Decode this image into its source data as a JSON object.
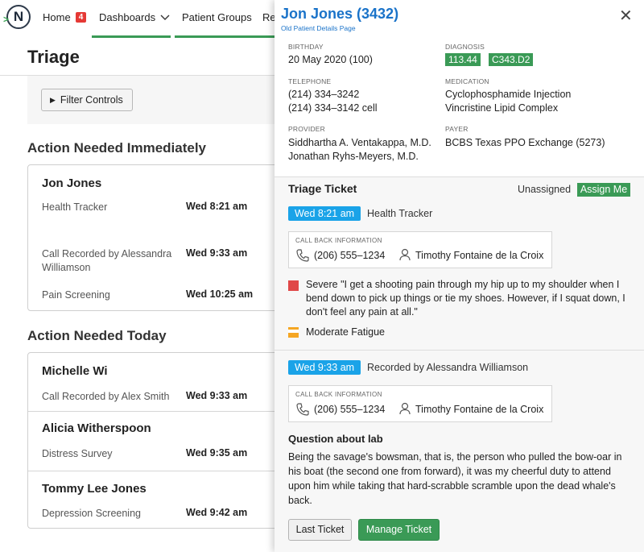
{
  "nav": {
    "home_label": "Home",
    "home_badge": "4",
    "dashboards_label": "Dashboards",
    "patient_groups_label": "Patient Groups",
    "truncated_label": "Re"
  },
  "page": {
    "title": "Triage",
    "filter_label": "Filter Controls"
  },
  "sections": {
    "immediate_title": "Action Needed Immediately",
    "today_title": "Action Needed Today"
  },
  "immediate_card": {
    "name": "Jon Jones",
    "rows": [
      {
        "label": "Health Tracker",
        "time": "Wed 8:21 am"
      },
      {
        "label": "Call Recorded by Alessandra Williamson",
        "time": "Wed 9:33 am"
      },
      {
        "label": "Pain Screening",
        "time": "Wed 10:25 am"
      }
    ]
  },
  "today_cards": [
    {
      "name": "Michelle Wi",
      "label": "Call Recorded by Alex Smith",
      "time": "Wed 9:33 am"
    },
    {
      "name": "Alicia Witherspoon",
      "label": "Distress Survey",
      "time": "Wed 9:35 am"
    },
    {
      "name": "Tommy Lee Jones",
      "label": "Depression Screening",
      "time": "Wed 9:42 am"
    }
  ],
  "panel": {
    "patient_name": "Jon Jones (3432)",
    "old_link": "Old Patient Details Page",
    "close_glyph": "✕",
    "birthday_label": "BIRTHDAY",
    "birthday": "20 May 2020 (100)",
    "diagnosis_label": "DIAGNOSIS",
    "diagnosis_codes": [
      "113.44",
      "C343.D2"
    ],
    "telephone_label": "TELEPHONE",
    "phone_1": "(214) 334–3242",
    "phone_2": "(214) 334–3142 cell",
    "medication_label": "MEDICATION",
    "medication_1": "Cyclophosphamide Injection",
    "medication_2": "Vincristine Lipid Complex",
    "provider_label": "PROVIDER",
    "provider_1": "Siddhartha A. Ventakappa, M.D.",
    "provider_2": "Jonathan Ryhs-Meyers, M.D.",
    "payer_label": "PAYER",
    "payer": "BCBS Texas PPO Exchange (5273)"
  },
  "ticket": {
    "title": "Triage Ticket",
    "status": "Unassigned",
    "assign_label": "Assign Me",
    "entries": [
      {
        "time": "Wed 8:21 am",
        "source": "Health Tracker",
        "callback_label": "CALL BACK INFORMATION",
        "phone": "(206) 555–1234",
        "contact": "Timothy Fontaine de la Croix"
      },
      {
        "time": "Wed 9:33 am",
        "source": "Recorded by Alessandra Williamson",
        "callback_label": "CALL BACK INFORMATION",
        "phone": "(206) 555–1234",
        "contact": "Timothy Fontaine de la Croix"
      }
    ],
    "severe_text": "Severe \"I get a shooting pain through my hip up to my shoulder when I bend down to pick up things or tie my shoes. However, if I squat down, I don't feel any pain at all.\"",
    "moderate_text": "Moderate Fatigue",
    "question_title": "Question about lab",
    "question_body": "Being the savage's bowsman, that is, the person who pulled the bow-oar in his boat (the second one from forward), it was my cheerful duty to attend upon him while taking that hard-scrabble scramble upon the dead whale's back.",
    "last_ticket_label": "Last Ticket",
    "manage_ticket_label": "Manage Ticket"
  },
  "colors": {
    "brand_green": "#3a9a56",
    "link_blue": "#1a73c9",
    "time_pill_blue": "#1aa3e8",
    "severe_red": "#e04848",
    "moderate_orange": "#f5a623",
    "badge_red": "#e53935"
  }
}
